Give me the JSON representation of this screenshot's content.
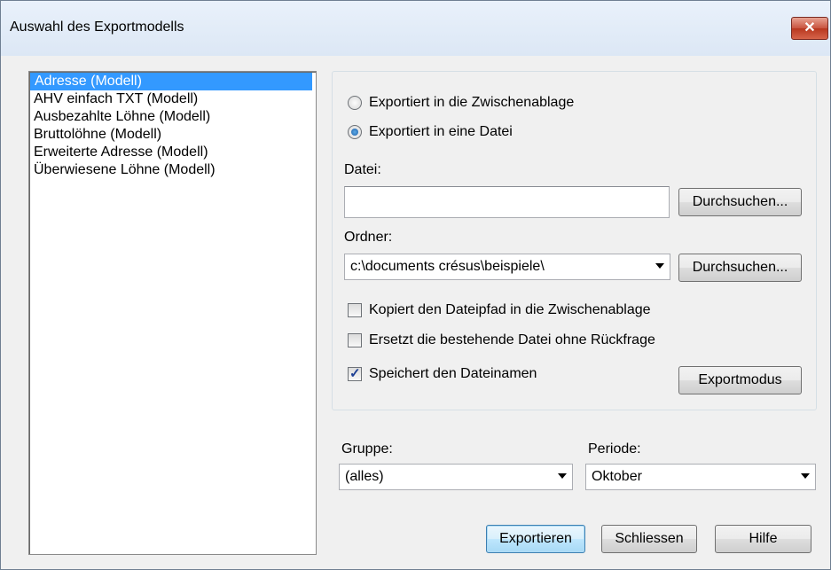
{
  "window": {
    "title": "Auswahl des Exportmodells",
    "close_glyph": "✕"
  },
  "models": [
    {
      "label": "Adresse (Modell)",
      "selected": true
    },
    {
      "label": "AHV einfach TXT (Modell)",
      "selected": false
    },
    {
      "label": "Ausbezahlte Löhne (Modell)",
      "selected": false
    },
    {
      "label": "Bruttolöhne (Modell)",
      "selected": false
    },
    {
      "label": "Erweiterte Adresse (Modell)",
      "selected": false
    },
    {
      "label": "Überwiesene Löhne (Modell)",
      "selected": false
    }
  ],
  "export": {
    "radio_clipboard": "Exportiert in die Zwischenablage",
    "radio_file": "Exportiert in eine Datei",
    "selected": "file"
  },
  "file": {
    "label": "Datei:",
    "value": "",
    "browse": "Durchsuchen..."
  },
  "folder": {
    "label": "Ordner:",
    "value": "c:\\documents crésus\\beispiele\\",
    "browse": "Durchsuchen..."
  },
  "options": {
    "copy_path": {
      "label": "Kopiert den Dateipfad in die Zwischenablage",
      "checked": false
    },
    "replace": {
      "label": "Ersetzt die bestehende Datei ohne Rückfrage",
      "checked": false
    },
    "save_name": {
      "label": "Speichert den Dateinamen",
      "checked": true
    },
    "mode_button": "Exportmodus"
  },
  "group": {
    "label": "Gruppe:",
    "value": "(alles)"
  },
  "period": {
    "label": "Periode:",
    "value": "Oktober"
  },
  "buttons": {
    "export": "Exportieren",
    "close": "Schliessen",
    "help": "Hilfe"
  }
}
